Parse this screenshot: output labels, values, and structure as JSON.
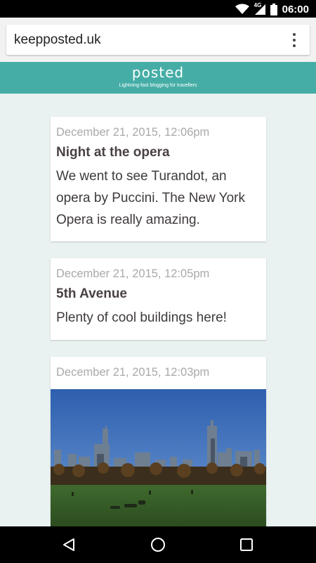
{
  "status_bar": {
    "time": "06:00",
    "network_label": "4G"
  },
  "browser": {
    "url": "keepposted.uk"
  },
  "site": {
    "logo": "posted",
    "tagline": "Lightning-fast blogging for travellers"
  },
  "posts": [
    {
      "date": "December 21, 2015, 12:06pm",
      "title": "Night at the opera",
      "lines": [
        "We went to see Turandot, an",
        "opera by Puccini. The New York",
        "Opera is really amazing."
      ]
    },
    {
      "date": "December 21, 2015, 12:05pm",
      "title": "5th Avenue",
      "lines": [
        "Plenty of cool buildings here!"
      ]
    },
    {
      "date": "December 21, 2015, 12:03pm",
      "title": "",
      "photo": "city-skyline-park-photo"
    }
  ],
  "nav": {
    "back": "back-icon",
    "home": "home-icon",
    "recents": "recents-icon"
  },
  "colors": {
    "header": "#45ada6",
    "background": "#e9f2f1",
    "date": "#a9a9a9",
    "title": "#4a4142"
  }
}
